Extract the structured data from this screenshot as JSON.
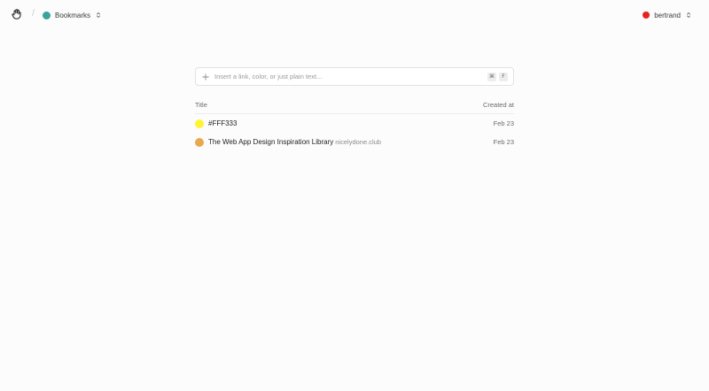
{
  "header": {
    "collection": {
      "label": "Bookmarks",
      "color": "#3aa39a"
    },
    "user": {
      "label": "bertrand",
      "color": "#e5241b"
    }
  },
  "search": {
    "placeholder": "Insert a link, color, or just plain text...",
    "shortcut_key1": "⌘",
    "shortcut_key2": "F"
  },
  "table": {
    "col_title": "Title",
    "col_created": "Created at",
    "rows": [
      {
        "title": "#FFF333",
        "domain": "",
        "created": "Feb 23",
        "color": "#FFF333"
      },
      {
        "title": "The Web App Design Inspiration Library",
        "domain": "nicelydone.club",
        "created": "Feb 23",
        "color": "#e9a84e"
      }
    ]
  }
}
